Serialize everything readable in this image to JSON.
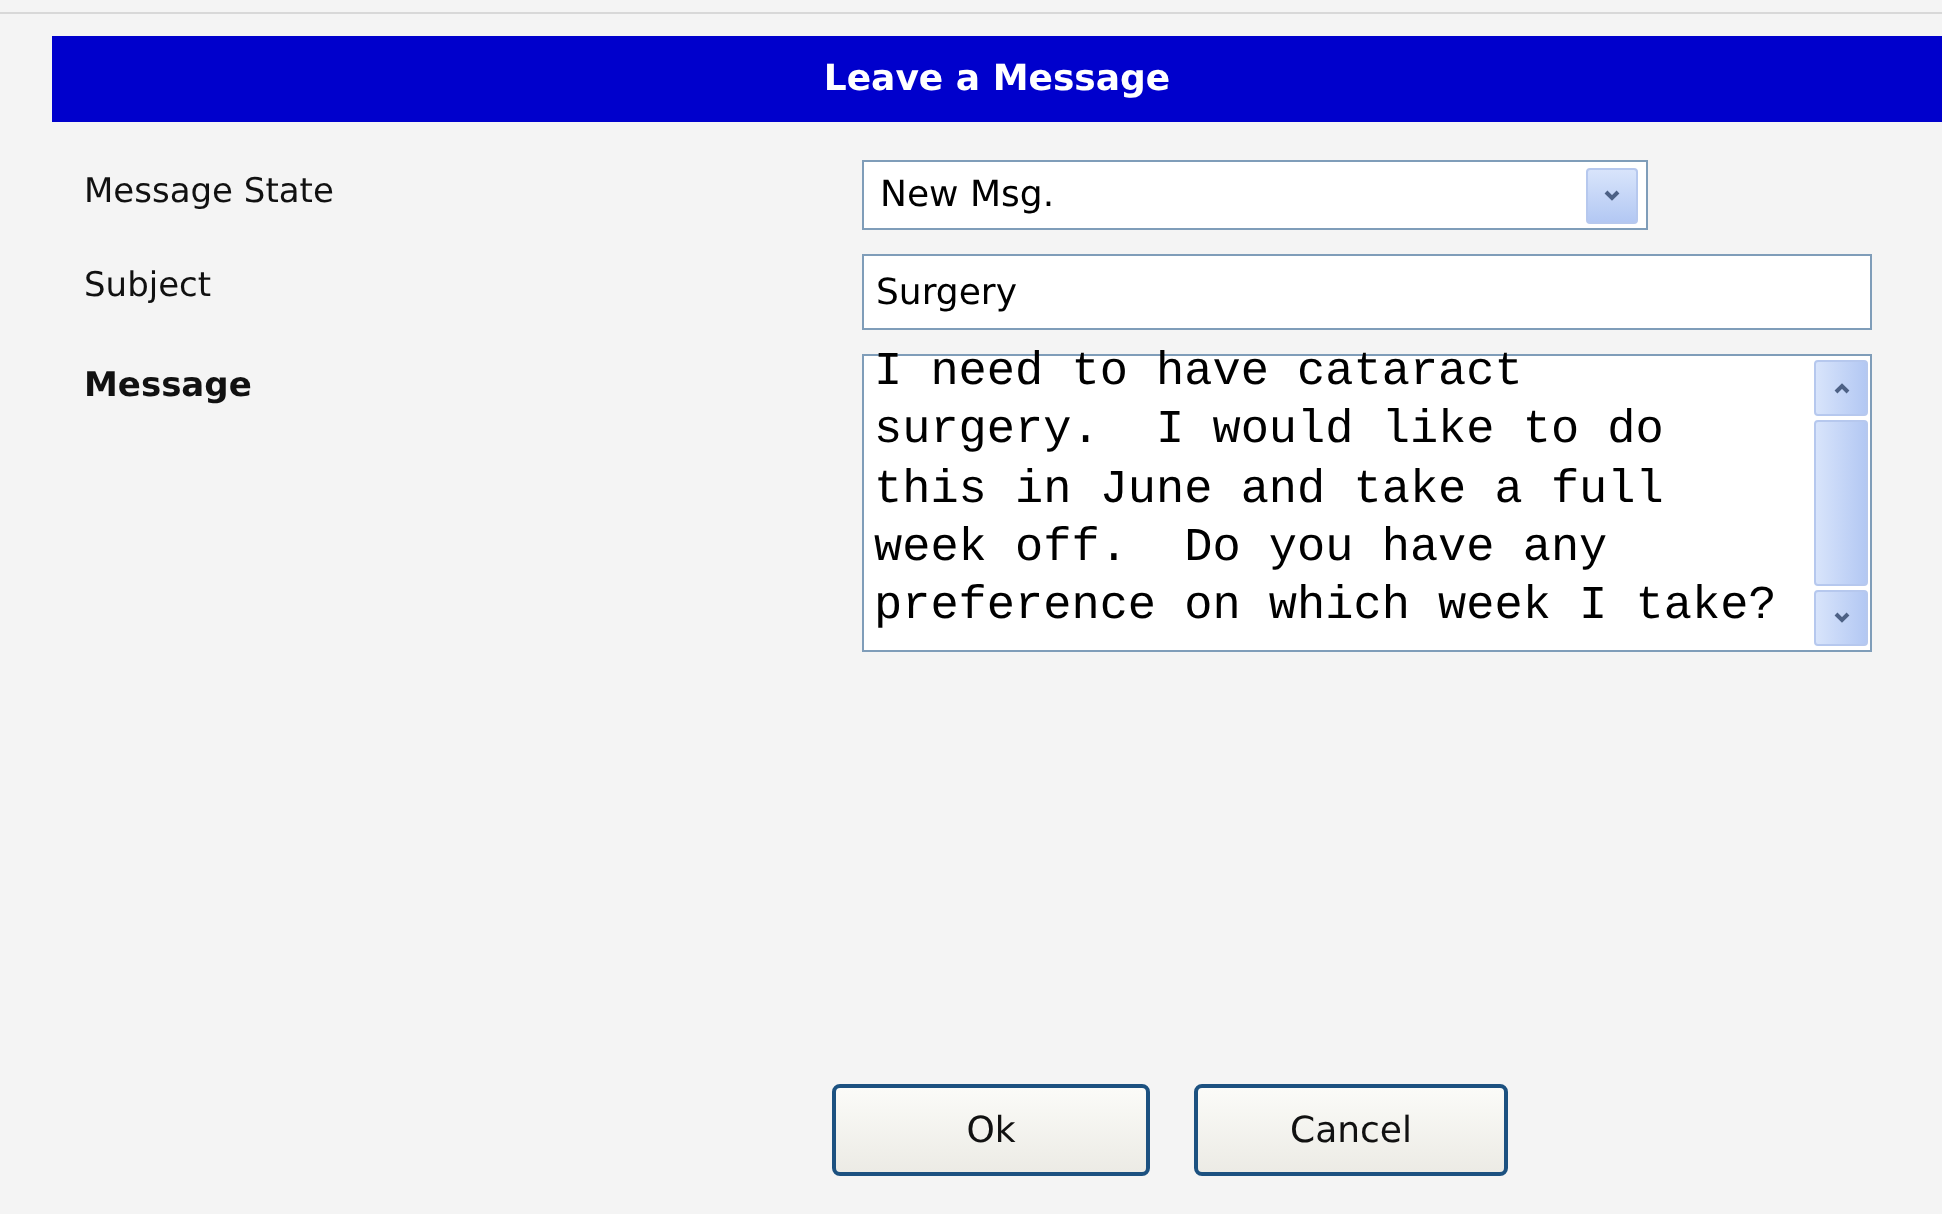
{
  "header": {
    "title": "Leave a Message"
  },
  "fields": [
    {
      "kind": "select",
      "label": "Message State",
      "bold": false,
      "value": "New Msg."
    },
    {
      "kind": "text",
      "label": "Subject",
      "bold": false,
      "value": "Surgery"
    },
    {
      "kind": "textarea",
      "label": "Message",
      "bold": true,
      "lines": [
        "I need to have cataract",
        "surgery.  I would like to do",
        "this in June and take a full",
        "week off.  Do you have any",
        "preference on which week I take?"
      ]
    }
  ],
  "buttons": [
    "Ok",
    "Cancel"
  ]
}
